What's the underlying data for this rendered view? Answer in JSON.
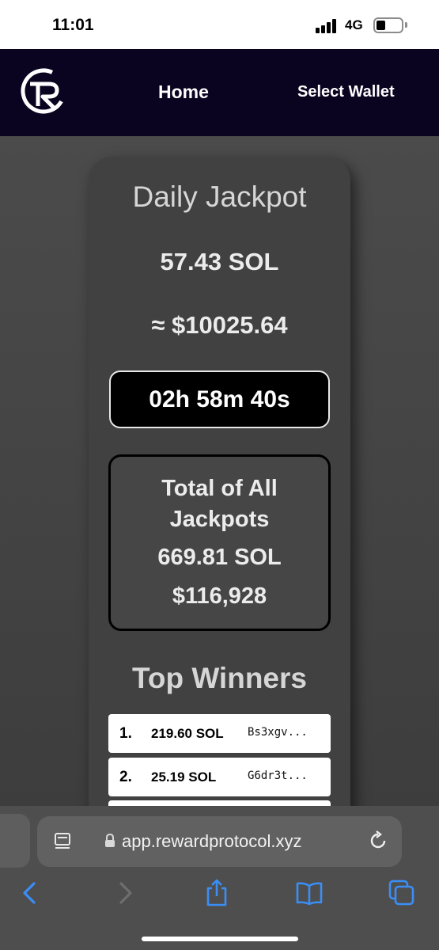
{
  "status_bar": {
    "time": "11:01",
    "network": "4G"
  },
  "header": {
    "logo_icon": "reward-protocol-logo-icon",
    "nav_home": "Home",
    "nav_wallet": "Select Wallet"
  },
  "jackpot": {
    "title": "Daily Jackpot",
    "sol_amount": "57.43 SOL",
    "usd_amount": "≈ $10025.64",
    "countdown": "02h 58m 40s"
  },
  "totals": {
    "title": "Total of All Jackpots",
    "sol_amount": "669.81 SOL",
    "usd_amount": "$116,928"
  },
  "winners": {
    "title": "Top Winners",
    "rows": [
      {
        "rank": "1.",
        "amount": "219.60 SOL",
        "address": "Bs3xgv..."
      },
      {
        "rank": "2.",
        "amount": "25.19 SOL",
        "address": "G6dr3t..."
      }
    ]
  },
  "browser": {
    "url": "app.rewardprotocol.xyz",
    "icons": [
      "reader-icon",
      "lock-icon",
      "reload-icon",
      "back-icon",
      "forward-icon",
      "share-icon",
      "bookmarks-icon",
      "tabs-icon"
    ],
    "accent_color": "#3a8ef6"
  }
}
